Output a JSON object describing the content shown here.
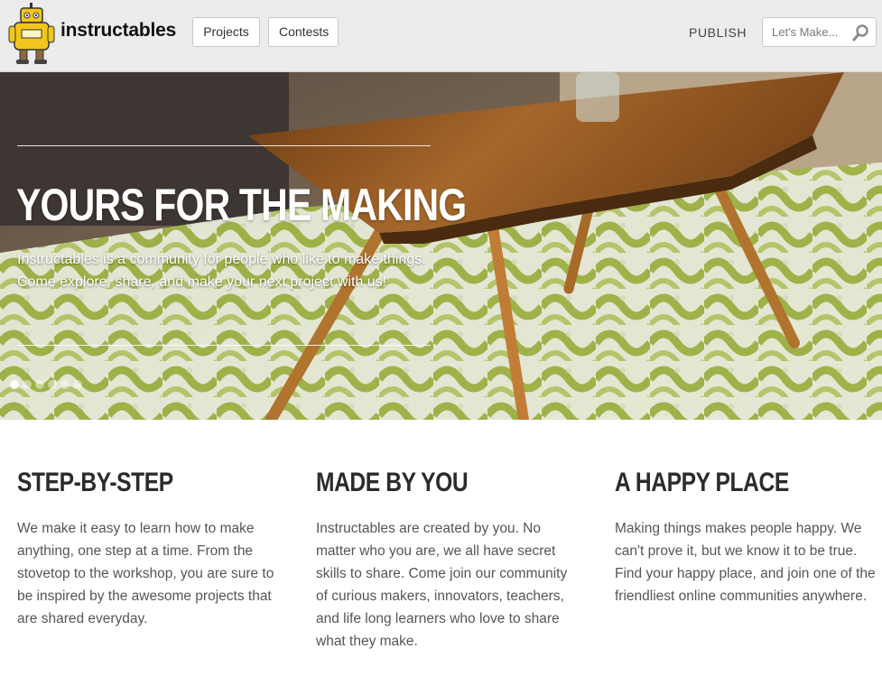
{
  "header": {
    "brand": "instructables",
    "nav": {
      "projects": "Projects",
      "contests": "Contests"
    },
    "publish": "PUBLISH",
    "search": {
      "placeholder": "Let's Make..."
    },
    "colors": {
      "header_bg": "#ececec",
      "logo_yellow": "#f3c61b"
    }
  },
  "hero": {
    "title": "YOURS FOR THE MAKING",
    "text": "Instructables is a community for people who like to make things. Come explore, share, and make your next project with us!",
    "slide_count": 6,
    "active_slide": 1
  },
  "features": [
    {
      "title": "STEP-BY-STEP",
      "text": "We make it easy to learn how to make anything, one step at a time. From the stovetop to the workshop, you are sure to be inspired by the awesome projects that are shared everyday."
    },
    {
      "title": "MADE BY YOU",
      "text": "Instructables are created by you. No matter who you are, we all have secret skills to share. Come join our community of curious makers, innovators, teachers, and life long learners who love to share what they make."
    },
    {
      "title": "A HAPPY PLACE",
      "text": "Making things makes people happy. We can't prove it, but we know it to be true. Find your happy place, and join one of the friendliest online communities anywhere."
    }
  ]
}
